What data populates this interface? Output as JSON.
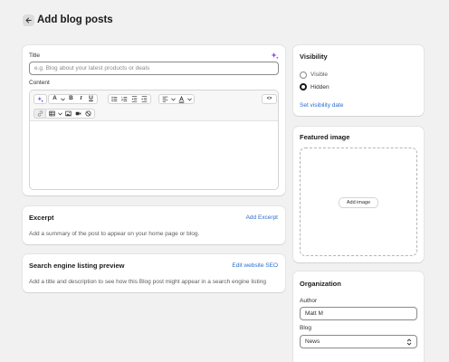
{
  "page": {
    "title": "Add blog posts"
  },
  "content_card": {
    "title_label": "Title",
    "title_placeholder": "e.g. Blog about your latest products or deals",
    "content_label": "Content"
  },
  "toolbar": {
    "bold": "B",
    "italic": "I",
    "underline": "U",
    "text_style": "A",
    "code": "<>"
  },
  "excerpt": {
    "heading": "Excerpt",
    "action": "Add Excerpt",
    "description": "Add a summary of the post to appear on your home page or blog."
  },
  "seo": {
    "heading": "Search engine listing preview",
    "action": "Edit website SEO",
    "description": "Add a title and description to see how this Blog post might appear in a search engine listing"
  },
  "visibility": {
    "heading": "Visibility",
    "options": [
      "Visible",
      "Hidden"
    ],
    "selected": "Hidden",
    "action": "Set visibility date"
  },
  "featured_image": {
    "heading": "Featured image",
    "button": "Add image"
  },
  "organization": {
    "heading": "Organization",
    "author_label": "Author",
    "author_value": "Matt M",
    "blog_label": "Blog",
    "blog_value": "News"
  },
  "colors": {
    "link": "#2c6ecb",
    "background": "#f1f1f1",
    "ai_accent": "#7c3aed"
  }
}
